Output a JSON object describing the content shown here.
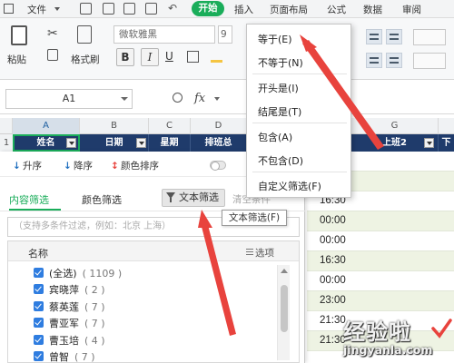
{
  "menubar": {
    "file": "文件",
    "start": "开始",
    "items": [
      "插入",
      "页面布局",
      "公式",
      "数据",
      "审阅"
    ]
  },
  "ribbon": {
    "paste": "粘贴",
    "format_painter": "格式刷",
    "font_name": "微软雅黑",
    "font_size": "9",
    "bold": "B",
    "italic": "I"
  },
  "formula_bar": {
    "cell_ref": "A1",
    "fx": "fx"
  },
  "grid": {
    "columns": [
      "A",
      "B",
      "C",
      "D",
      "G"
    ],
    "row_number": "1",
    "headers": {
      "name": "姓名",
      "date": "日期",
      "week": "星期",
      "schedule": "排班总",
      "shift2": "上班2",
      "off": "下"
    },
    "times": [
      "16:30",
      "00:00",
      "00:00",
      "16:30",
      "00:00",
      "23:00",
      "21:30",
      "21:30"
    ]
  },
  "filter_panel": {
    "sort_asc": "升序",
    "sort_desc": "降序",
    "color_sort": "颜色排序",
    "tab_content": "内容筛选",
    "tab_color": "颜色筛选",
    "text_filter": "文本筛选",
    "clear_condition": "清空条件",
    "search_placeholder": "（支持多条件过滤，例如：北京 上海）",
    "list_header": "名称",
    "options": "选项",
    "items": [
      {
        "label": "(全选)",
        "count": "( 1109 )"
      },
      {
        "label": "宾晓萍",
        "count": "( 2 )"
      },
      {
        "label": "蔡英莲",
        "count": "( 7 )"
      },
      {
        "label": "曹亚军",
        "count": "( 7 )"
      },
      {
        "label": "曹玉培",
        "count": "( 4 )"
      },
      {
        "label": "曾智",
        "count": "( 7 )"
      }
    ]
  },
  "tooltip": "文本筛选(F)",
  "dropdown": {
    "items": [
      "等于(E)",
      "不等于(N)",
      "开头是(I)",
      "结尾是(T)",
      "包含(A)",
      "不包含(D)",
      "自定义筛选(F)"
    ]
  },
  "watermark": {
    "line1": "经验啦",
    "line2": "jingyanla.com"
  },
  "colors": {
    "accent_green": "#1aad5a",
    "header_navy": "#1f3b6b",
    "arrow_red": "#e8433d",
    "checkbox_blue": "#2f7de0"
  }
}
